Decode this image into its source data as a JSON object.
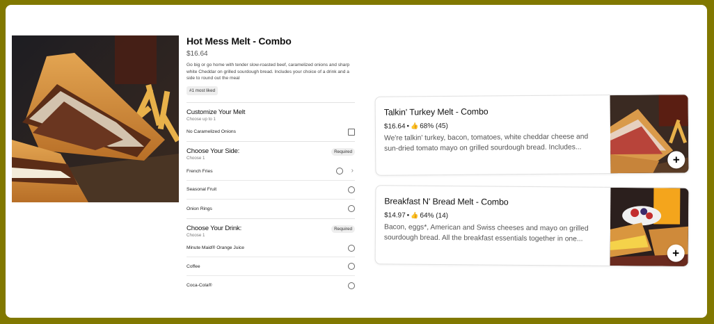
{
  "item": {
    "title": "Hot Mess Melt - Combo",
    "price": "$16.64",
    "description": "Go big or go home with tender slow-roasted beef, caramelized onions and sharp white Cheddar on grilled sourdough bread. Includes your choice of a drink and a side to round out the meal",
    "badge": "#1 most liked"
  },
  "customize": {
    "title": "Customize Your Melt",
    "subtitle": "Choose up to 1",
    "options": [
      {
        "label": "No Caramelized Onions"
      }
    ]
  },
  "side": {
    "title": "Choose Your Side:",
    "subtitle": "Choose 1",
    "required": "Required",
    "options": [
      {
        "label": "French Fries"
      },
      {
        "label": "Seasonal Fruit"
      },
      {
        "label": "Onion Rings"
      }
    ]
  },
  "drink": {
    "title": "Choose Your Drink:",
    "subtitle": "Choose 1",
    "required": "Required",
    "options": [
      {
        "label": "Minute Maid® Orange Juice"
      },
      {
        "label": "Coffee"
      },
      {
        "label": "Coca-Cola®"
      }
    ]
  },
  "recommendations": [
    {
      "title": "Talkin' Turkey Melt - Combo",
      "price": "$16.64",
      "separator": "•",
      "rating": "68% (45)",
      "description": "We're talkin' turkey, bacon, tomatoes, white cheddar cheese and sun-dried tomato mayo on grilled sourdough bread. Includes...",
      "add_label": "+"
    },
    {
      "title": "Breakfast N' Bread Melt - Combo",
      "price": "$14.97",
      "separator": "•",
      "rating": "64% (14)",
      "description": "Bacon, eggs*, American and Swiss cheeses and mayo on grilled sourdough bread. All the breakfast essentials together in one...",
      "add_label": "+"
    }
  ],
  "icons": {
    "thumbs_up": "👍",
    "chevron": "›"
  },
  "colors": {
    "frame_border": "#817800",
    "rating_green": "#2e7d32"
  }
}
